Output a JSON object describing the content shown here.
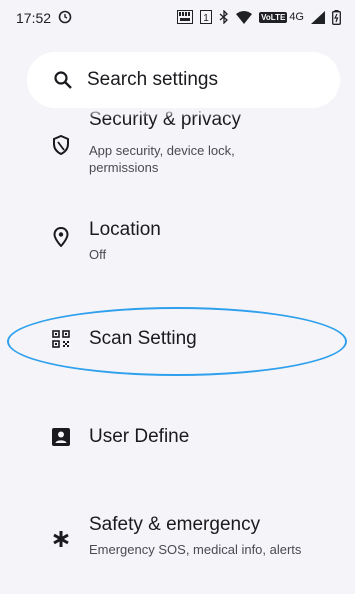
{
  "status_bar": {
    "time": "17:52",
    "network_type": "4G",
    "volte_badge": "VoLTE",
    "icons": [
      "alarm-icon",
      "keyboard-icon",
      "sim-1-icon",
      "bluetooth-icon",
      "wifi-icon",
      "signal-icon",
      "battery-icon"
    ]
  },
  "search": {
    "label": "Search settings"
  },
  "settings_items": [
    {
      "title": "Security & privacy",
      "subtitle": "App security, device lock, permissions",
      "subtitle_line1": "App security, device lock,",
      "subtitle_line2": "permissions",
      "icon": "shield-icon"
    },
    {
      "title": "Location",
      "subtitle": "Off",
      "icon": "location-pin-icon"
    },
    {
      "title": "Scan Setting",
      "subtitle": "",
      "icon": "qr-scan-icon"
    },
    {
      "title": "User Define",
      "subtitle": "",
      "icon": "account-box-icon"
    },
    {
      "title": "Safety & emergency",
      "subtitle": "Emergency SOS, medical info, alerts",
      "icon": "asterisk-icon"
    }
  ],
  "annotation": {
    "highlight_color": "#2ea0ee",
    "highlighted_item": "Scan Setting"
  }
}
